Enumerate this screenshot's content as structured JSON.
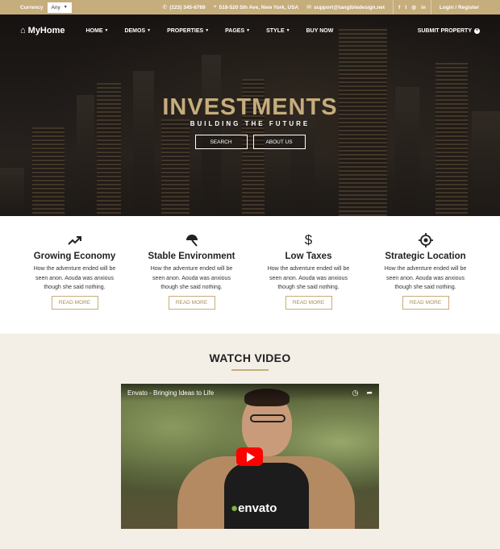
{
  "topbar": {
    "currency_label": "Currency",
    "currency_value": "Any",
    "phone": "(123) 345-6789",
    "address": "518-520 5th Ave, New York, USA",
    "email": "support@tangibledesign.net",
    "social": [
      "facebook-icon",
      "twitter-icon",
      "instagram-icon",
      "linkedin-icon"
    ],
    "login": "Login / Register"
  },
  "nav": {
    "logo": "MyHome",
    "items": [
      {
        "label": "HOME",
        "dropdown": true
      },
      {
        "label": "DEMOS",
        "dropdown": true
      },
      {
        "label": "PROPERTIES",
        "dropdown": true
      },
      {
        "label": "PAGES",
        "dropdown": true
      },
      {
        "label": "STYLE",
        "dropdown": true
      },
      {
        "label": "BUY NOW",
        "dropdown": false
      }
    ],
    "submit": "SUBMIT PROPERTY"
  },
  "hero": {
    "title": "INVESTMENTS",
    "subtitle": "BUILDING THE FUTURE",
    "buttons": [
      "SEARCH",
      "ABOUT US"
    ]
  },
  "features": [
    {
      "icon": "trending-up-icon",
      "title": "Growing Economy",
      "text": "How the adventure ended will be seen anon. Aouda was anxious though she said nothing.",
      "button": "READ MORE"
    },
    {
      "icon": "umbrella-icon",
      "title": "Stable Environment",
      "text": "How the adventure ended will be seen anon. Aouda was anxious though she said nothing.",
      "button": "READ MORE"
    },
    {
      "icon": "dollar-icon",
      "title": "Low Taxes",
      "text": "How the adventure ended will be seen anon. Aouda was anxious though she said nothing.",
      "button": "READ MORE"
    },
    {
      "icon": "target-icon",
      "title": "Strategic Location",
      "text": "How the adventure ended will be seen anon. Aouda was anxious though she said nothing.",
      "button": "READ MORE"
    }
  ],
  "video": {
    "section_title": "WATCH VIDEO",
    "title": "Envato - Bringing Ideas to Life",
    "brand": "envato"
  },
  "colors": {
    "accent": "#c6ad7c",
    "play": "#ff0000",
    "dark": "#222222"
  }
}
